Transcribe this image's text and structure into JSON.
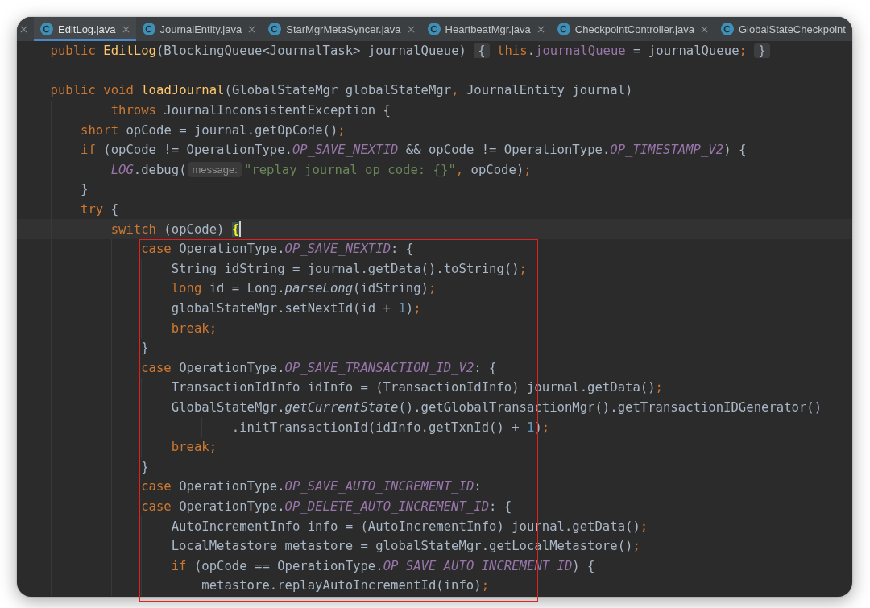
{
  "tabs": [
    {
      "label": "EditLog.java",
      "selected": true
    },
    {
      "label": "JournalEntity.java",
      "selected": false
    },
    {
      "label": "StarMgrMetaSyncer.java",
      "selected": false
    },
    {
      "label": "HeartbeatMgr.java",
      "selected": false
    },
    {
      "label": "CheckpointController.java",
      "selected": false
    },
    {
      "label": "GlobalStateCheckpoint",
      "selected": false
    }
  ],
  "lines": [
    {
      "kind": "code",
      "current": false,
      "tokens": [
        {
          "kind": "keyword",
          "text": "    public "
        },
        {
          "kind": "decl",
          "text": "EditLog"
        },
        {
          "kind": "plain",
          "text": "(BlockingQueue<JournalTask> journalQueue) "
        },
        {
          "kind": "fold",
          "text": "{"
        },
        {
          "kind": "keyword",
          "text": " this"
        },
        {
          "kind": "plain",
          "text": "."
        },
        {
          "kind": "field",
          "text": "journalQueue"
        },
        {
          "kind": "plain",
          "text": " = journalQueue"
        },
        {
          "kind": "punct",
          "text": "; "
        },
        {
          "kind": "fold",
          "text": "}"
        }
      ]
    },
    {
      "kind": "blank",
      "current": false
    },
    {
      "kind": "code",
      "current": false,
      "tokens": [
        {
          "kind": "keyword",
          "text": "    public void "
        },
        {
          "kind": "decl",
          "text": "loadJournal"
        },
        {
          "kind": "plain",
          "text": "(GlobalStateMgr globalStateMgr"
        },
        {
          "kind": "punct",
          "text": ","
        },
        {
          "kind": "plain",
          "text": " JournalEntity journal)"
        }
      ]
    },
    {
      "kind": "code",
      "current": false,
      "tokens": [
        {
          "kind": "keyword",
          "text": "            throws "
        },
        {
          "kind": "plain",
          "text": "JournalInconsistentException {"
        }
      ]
    },
    {
      "kind": "code",
      "current": false,
      "tokens": [
        {
          "kind": "keyword",
          "text": "        short "
        },
        {
          "kind": "plain",
          "text": "opCode = journal.getOpCode()"
        },
        {
          "kind": "punct",
          "text": ";"
        }
      ]
    },
    {
      "kind": "code",
      "current": false,
      "tokens": [
        {
          "kind": "keyword",
          "text": "        if "
        },
        {
          "kind": "plain",
          "text": "(opCode != OperationType."
        },
        {
          "kind": "constant",
          "text": "OP_SAVE_NEXTID"
        },
        {
          "kind": "plain",
          "text": " && opCode != OperationType."
        },
        {
          "kind": "constant",
          "text": "OP_TIMESTAMP_V2"
        },
        {
          "kind": "plain",
          "text": ") {"
        }
      ]
    },
    {
      "kind": "code",
      "current": false,
      "tokens": [
        {
          "kind": "constant",
          "text": "            LOG"
        },
        {
          "kind": "plain",
          "text": ".debug("
        },
        {
          "kind": "hint",
          "text": "message:"
        },
        {
          "kind": "string",
          "text": "\"replay journal op code: {}\""
        },
        {
          "kind": "punct",
          "text": ","
        },
        {
          "kind": "plain",
          "text": " opCode)"
        },
        {
          "kind": "punct",
          "text": ";"
        }
      ]
    },
    {
      "kind": "code",
      "current": false,
      "tokens": [
        {
          "kind": "plain",
          "text": "        }"
        }
      ]
    },
    {
      "kind": "code",
      "current": false,
      "tokens": [
        {
          "kind": "keyword",
          "text": "        try "
        },
        {
          "kind": "plain",
          "text": "{"
        }
      ]
    },
    {
      "kind": "code",
      "current": true,
      "tokens": [
        {
          "kind": "keyword",
          "text": "            switch "
        },
        {
          "kind": "plain",
          "text": "(opCode) "
        },
        {
          "kind": "brace",
          "text": "{"
        }
      ]
    },
    {
      "kind": "code",
      "current": false,
      "tokens": [
        {
          "kind": "keyword",
          "text": "                case "
        },
        {
          "kind": "plain",
          "text": "OperationType."
        },
        {
          "kind": "constant",
          "text": "OP_SAVE_NEXTID"
        },
        {
          "kind": "plain",
          "text": ": {"
        }
      ]
    },
    {
      "kind": "code",
      "current": false,
      "tokens": [
        {
          "kind": "plain",
          "text": "                    String idString = journal.getData().toString()"
        },
        {
          "kind": "punct",
          "text": ";"
        }
      ]
    },
    {
      "kind": "code",
      "current": false,
      "tokens": [
        {
          "kind": "keyword",
          "text": "                    long "
        },
        {
          "kind": "plain",
          "text": "id = Long."
        },
        {
          "kind": "static",
          "text": "parseLong"
        },
        {
          "kind": "plain",
          "text": "(idString)"
        },
        {
          "kind": "punct",
          "text": ";"
        }
      ]
    },
    {
      "kind": "code",
      "current": false,
      "tokens": [
        {
          "kind": "plain",
          "text": "                    globalStateMgr.setNextId(id + "
        },
        {
          "kind": "number",
          "text": "1"
        },
        {
          "kind": "plain",
          "text": ")"
        },
        {
          "kind": "punct",
          "text": ";"
        }
      ]
    },
    {
      "kind": "code",
      "current": false,
      "tokens": [
        {
          "kind": "keyword",
          "text": "                    break"
        },
        {
          "kind": "punct",
          "text": ";"
        }
      ]
    },
    {
      "kind": "code",
      "current": false,
      "tokens": [
        {
          "kind": "plain",
          "text": "                }"
        }
      ]
    },
    {
      "kind": "code",
      "current": false,
      "tokens": [
        {
          "kind": "keyword",
          "text": "                case "
        },
        {
          "kind": "plain",
          "text": "OperationType."
        },
        {
          "kind": "constant",
          "text": "OP_SAVE_TRANSACTION_ID_V2"
        },
        {
          "kind": "plain",
          "text": ": {"
        }
      ]
    },
    {
      "kind": "code",
      "current": false,
      "tokens": [
        {
          "kind": "plain",
          "text": "                    TransactionIdInfo idInfo = (TransactionIdInfo) journal.getData()"
        },
        {
          "kind": "punct",
          "text": ";"
        }
      ]
    },
    {
      "kind": "code",
      "current": false,
      "tokens": [
        {
          "kind": "plain",
          "text": "                    GlobalStateMgr."
        },
        {
          "kind": "static",
          "text": "getCurrentState"
        },
        {
          "kind": "plain",
          "text": "().getGlobalTransactionMgr().getTransactionIDGenerator()"
        }
      ]
    },
    {
      "kind": "code",
      "current": false,
      "tokens": [
        {
          "kind": "plain",
          "text": "                            .initTransactionId(idInfo.getTxnId() + "
        },
        {
          "kind": "number",
          "text": "1"
        },
        {
          "kind": "plain",
          "text": ")"
        },
        {
          "kind": "punct",
          "text": ";"
        }
      ]
    },
    {
      "kind": "code",
      "current": false,
      "tokens": [
        {
          "kind": "keyword",
          "text": "                    break"
        },
        {
          "kind": "punct",
          "text": ";"
        }
      ]
    },
    {
      "kind": "code",
      "current": false,
      "tokens": [
        {
          "kind": "plain",
          "text": "                }"
        }
      ]
    },
    {
      "kind": "code",
      "current": false,
      "tokens": [
        {
          "kind": "keyword",
          "text": "                case "
        },
        {
          "kind": "plain",
          "text": "OperationType."
        },
        {
          "kind": "constant",
          "text": "OP_SAVE_AUTO_INCREMENT_ID"
        },
        {
          "kind": "plain",
          "text": ":"
        }
      ]
    },
    {
      "kind": "code",
      "current": false,
      "tokens": [
        {
          "kind": "keyword",
          "text": "                case "
        },
        {
          "kind": "plain",
          "text": "OperationType."
        },
        {
          "kind": "constant",
          "text": "OP_DELETE_AUTO_INCREMENT_ID"
        },
        {
          "kind": "plain",
          "text": ": {"
        }
      ]
    },
    {
      "kind": "code",
      "current": false,
      "tokens": [
        {
          "kind": "plain",
          "text": "                    AutoIncrementInfo info = (AutoIncrementInfo) journal.getData()"
        },
        {
          "kind": "punct",
          "text": ";"
        }
      ]
    },
    {
      "kind": "code",
      "current": false,
      "tokens": [
        {
          "kind": "plain",
          "text": "                    LocalMetastore metastore = globalStateMgr.getLocalMetastore()"
        },
        {
          "kind": "punct",
          "text": ";"
        }
      ]
    },
    {
      "kind": "code",
      "current": false,
      "tokens": [
        {
          "kind": "keyword",
          "text": "                    if "
        },
        {
          "kind": "plain",
          "text": "(opCode == OperationType."
        },
        {
          "kind": "constant",
          "text": "OP_SAVE_AUTO_INCREMENT_ID"
        },
        {
          "kind": "plain",
          "text": ") {"
        }
      ]
    },
    {
      "kind": "code",
      "current": false,
      "tokens": [
        {
          "kind": "plain",
          "text": "                        metastore.replayAutoIncrementId(info)"
        },
        {
          "kind": "punct",
          "text": ";"
        }
      ]
    }
  ]
}
